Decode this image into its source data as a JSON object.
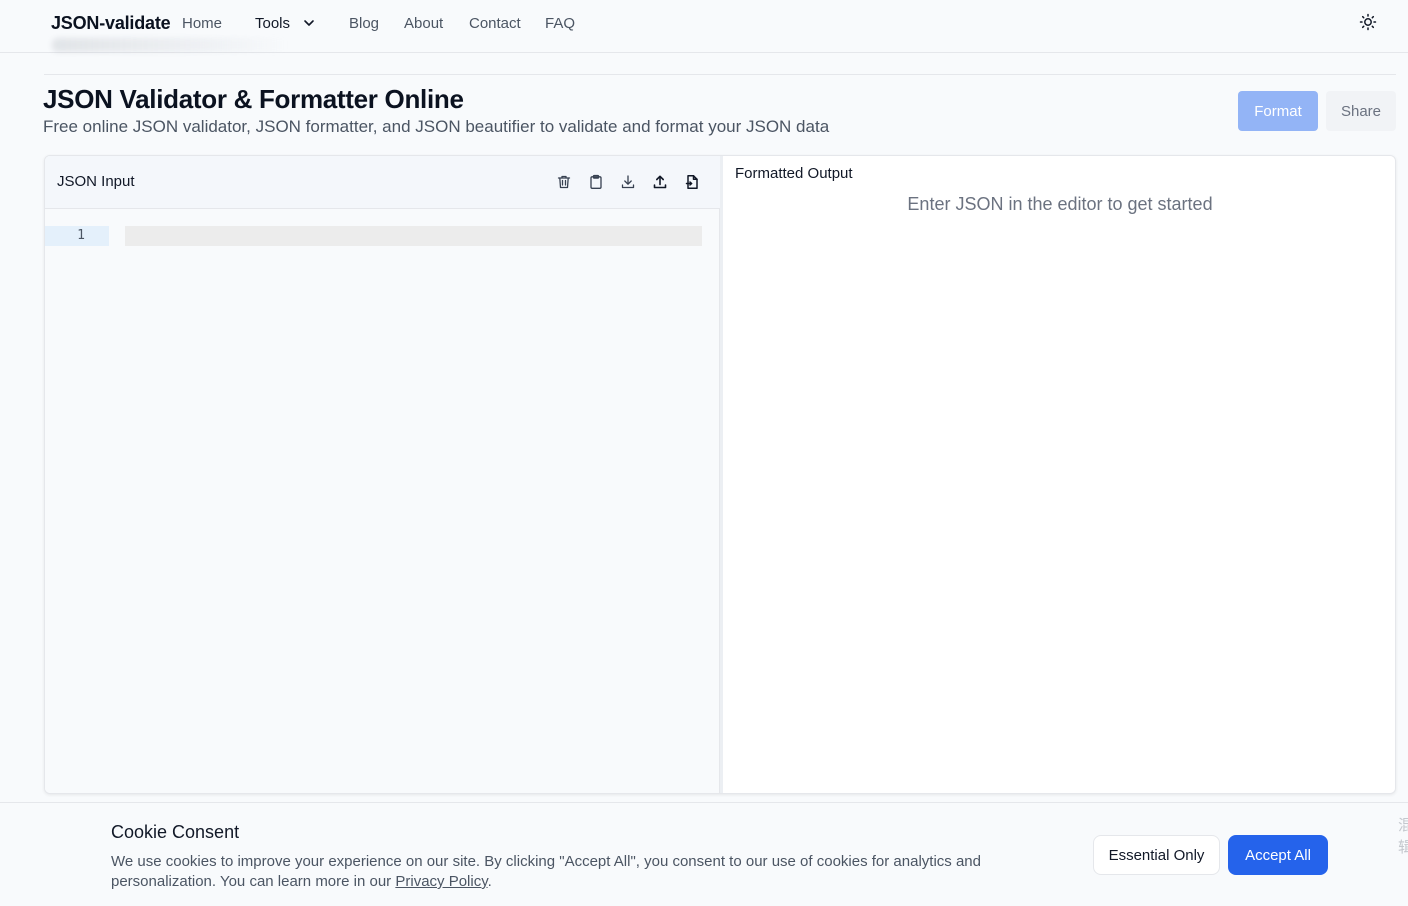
{
  "nav": {
    "brand": "JSON-validate",
    "links": {
      "home": "Home",
      "tools": "Tools",
      "blog": "Blog",
      "about": "About",
      "contact": "Contact",
      "faq": "FAQ"
    },
    "theme_icon": "sun-icon",
    "tools_icon": "chevron-down-icon"
  },
  "header": {
    "title": "JSON Validator & Formatter Online",
    "subtitle": "Free online JSON validator, JSON formatter, and JSON beautifier to validate and format your JSON data",
    "format_label": "Format",
    "share_label": "Share"
  },
  "editor": {
    "input_title": "JSON Input",
    "toolbar_icons": [
      "trash-icon",
      "clipboard-icon",
      "download-icon",
      "upload-icon",
      "file-import-icon"
    ],
    "line_numbers": [
      "1"
    ],
    "output_title": "Formatted Output",
    "output_placeholder": "Enter JSON in the editor to get started"
  },
  "cookie": {
    "title": "Cookie Consent",
    "text": "We use cookies to improve your experience on our site. By clicking \"Accept All\", you consent to our use of cookies for analytics and personalization. You can learn more in our ",
    "link_label": "Privacy Policy",
    "text_end": ".",
    "essential_label": "Essential Only",
    "accept_label": "Accept All",
    "edge_glyphs": "混辑"
  },
  "colors": {
    "accent": "#2563eb",
    "format_button": "#93b4f6",
    "background": "#f8fafc",
    "active_line": "#e4f0fb"
  }
}
